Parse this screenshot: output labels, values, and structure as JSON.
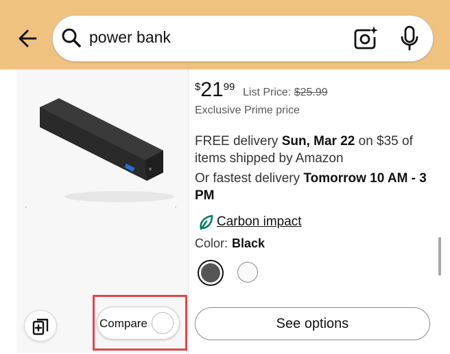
{
  "search": {
    "query": "power bank"
  },
  "icons": {
    "back": "arrow-left-icon",
    "search": "search-icon",
    "camera": "camera-lens-icon",
    "mic": "microphone-icon",
    "leaf": "leaf-icon",
    "compare_list": "compare-cards-icon"
  },
  "product": {
    "price_symbol": "$",
    "price_whole": "21",
    "price_fraction": "99",
    "list_price_label": "List Price:",
    "list_price_value": "$25.99",
    "prime_text": "Exclusive Prime price",
    "delivery_prefix": "FREE delivery ",
    "delivery_date": "Sun, Mar 22",
    "delivery_suffix": " on $35 of items shipped by Amazon",
    "fastest_prefix": "Or fastest delivery ",
    "fastest_time": "Tomorrow 10 AM - 3 PM",
    "carbon_link": "Carbon impact",
    "color_label": "Color:",
    "color_value": "Black"
  },
  "actions": {
    "compare_label": "Compare",
    "see_options_label": "See options"
  },
  "colors": {
    "header_bg": "#f0c27f",
    "leaf_green": "#067d62",
    "highlight_red": "#e0464a",
    "swatch_black": "#555555",
    "swatch_white": "#fafafa"
  }
}
